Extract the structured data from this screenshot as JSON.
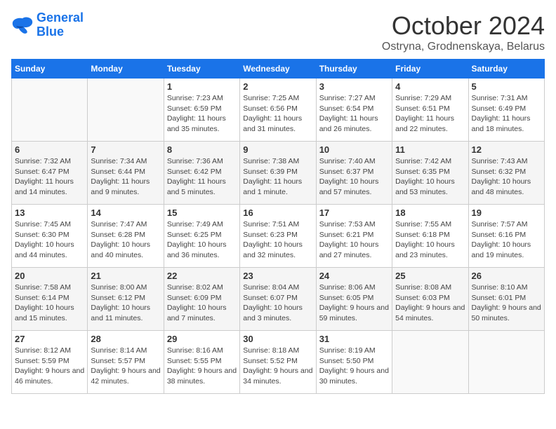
{
  "logo": {
    "line1": "General",
    "line2": "Blue"
  },
  "title": "October 2024",
  "subtitle": "Ostryna, Grodnenskaya, Belarus",
  "weekdays": [
    "Sunday",
    "Monday",
    "Tuesday",
    "Wednesday",
    "Thursday",
    "Friday",
    "Saturday"
  ],
  "weeks": [
    [
      {
        "day": "",
        "detail": ""
      },
      {
        "day": "",
        "detail": ""
      },
      {
        "day": "1",
        "detail": "Sunrise: 7:23 AM\nSunset: 6:59 PM\nDaylight: 11 hours and 35 minutes."
      },
      {
        "day": "2",
        "detail": "Sunrise: 7:25 AM\nSunset: 6:56 PM\nDaylight: 11 hours and 31 minutes."
      },
      {
        "day": "3",
        "detail": "Sunrise: 7:27 AM\nSunset: 6:54 PM\nDaylight: 11 hours and 26 minutes."
      },
      {
        "day": "4",
        "detail": "Sunrise: 7:29 AM\nSunset: 6:51 PM\nDaylight: 11 hours and 22 minutes."
      },
      {
        "day": "5",
        "detail": "Sunrise: 7:31 AM\nSunset: 6:49 PM\nDaylight: 11 hours and 18 minutes."
      }
    ],
    [
      {
        "day": "6",
        "detail": "Sunrise: 7:32 AM\nSunset: 6:47 PM\nDaylight: 11 hours and 14 minutes."
      },
      {
        "day": "7",
        "detail": "Sunrise: 7:34 AM\nSunset: 6:44 PM\nDaylight: 11 hours and 9 minutes."
      },
      {
        "day": "8",
        "detail": "Sunrise: 7:36 AM\nSunset: 6:42 PM\nDaylight: 11 hours and 5 minutes."
      },
      {
        "day": "9",
        "detail": "Sunrise: 7:38 AM\nSunset: 6:39 PM\nDaylight: 11 hours and 1 minute."
      },
      {
        "day": "10",
        "detail": "Sunrise: 7:40 AM\nSunset: 6:37 PM\nDaylight: 10 hours and 57 minutes."
      },
      {
        "day": "11",
        "detail": "Sunrise: 7:42 AM\nSunset: 6:35 PM\nDaylight: 10 hours and 53 minutes."
      },
      {
        "day": "12",
        "detail": "Sunrise: 7:43 AM\nSunset: 6:32 PM\nDaylight: 10 hours and 48 minutes."
      }
    ],
    [
      {
        "day": "13",
        "detail": "Sunrise: 7:45 AM\nSunset: 6:30 PM\nDaylight: 10 hours and 44 minutes."
      },
      {
        "day": "14",
        "detail": "Sunrise: 7:47 AM\nSunset: 6:28 PM\nDaylight: 10 hours and 40 minutes."
      },
      {
        "day": "15",
        "detail": "Sunrise: 7:49 AM\nSunset: 6:25 PM\nDaylight: 10 hours and 36 minutes."
      },
      {
        "day": "16",
        "detail": "Sunrise: 7:51 AM\nSunset: 6:23 PM\nDaylight: 10 hours and 32 minutes."
      },
      {
        "day": "17",
        "detail": "Sunrise: 7:53 AM\nSunset: 6:21 PM\nDaylight: 10 hours and 27 minutes."
      },
      {
        "day": "18",
        "detail": "Sunrise: 7:55 AM\nSunset: 6:18 PM\nDaylight: 10 hours and 23 minutes."
      },
      {
        "day": "19",
        "detail": "Sunrise: 7:57 AM\nSunset: 6:16 PM\nDaylight: 10 hours and 19 minutes."
      }
    ],
    [
      {
        "day": "20",
        "detail": "Sunrise: 7:58 AM\nSunset: 6:14 PM\nDaylight: 10 hours and 15 minutes."
      },
      {
        "day": "21",
        "detail": "Sunrise: 8:00 AM\nSunset: 6:12 PM\nDaylight: 10 hours and 11 minutes."
      },
      {
        "day": "22",
        "detail": "Sunrise: 8:02 AM\nSunset: 6:09 PM\nDaylight: 10 hours and 7 minutes."
      },
      {
        "day": "23",
        "detail": "Sunrise: 8:04 AM\nSunset: 6:07 PM\nDaylight: 10 hours and 3 minutes."
      },
      {
        "day": "24",
        "detail": "Sunrise: 8:06 AM\nSunset: 6:05 PM\nDaylight: 9 hours and 59 minutes."
      },
      {
        "day": "25",
        "detail": "Sunrise: 8:08 AM\nSunset: 6:03 PM\nDaylight: 9 hours and 54 minutes."
      },
      {
        "day": "26",
        "detail": "Sunrise: 8:10 AM\nSunset: 6:01 PM\nDaylight: 9 hours and 50 minutes."
      }
    ],
    [
      {
        "day": "27",
        "detail": "Sunrise: 8:12 AM\nSunset: 5:59 PM\nDaylight: 9 hours and 46 minutes."
      },
      {
        "day": "28",
        "detail": "Sunrise: 8:14 AM\nSunset: 5:57 PM\nDaylight: 9 hours and 42 minutes."
      },
      {
        "day": "29",
        "detail": "Sunrise: 8:16 AM\nSunset: 5:55 PM\nDaylight: 9 hours and 38 minutes."
      },
      {
        "day": "30",
        "detail": "Sunrise: 8:18 AM\nSunset: 5:52 PM\nDaylight: 9 hours and 34 minutes."
      },
      {
        "day": "31",
        "detail": "Sunrise: 8:19 AM\nSunset: 5:50 PM\nDaylight: 9 hours and 30 minutes."
      },
      {
        "day": "",
        "detail": ""
      },
      {
        "day": "",
        "detail": ""
      }
    ]
  ]
}
